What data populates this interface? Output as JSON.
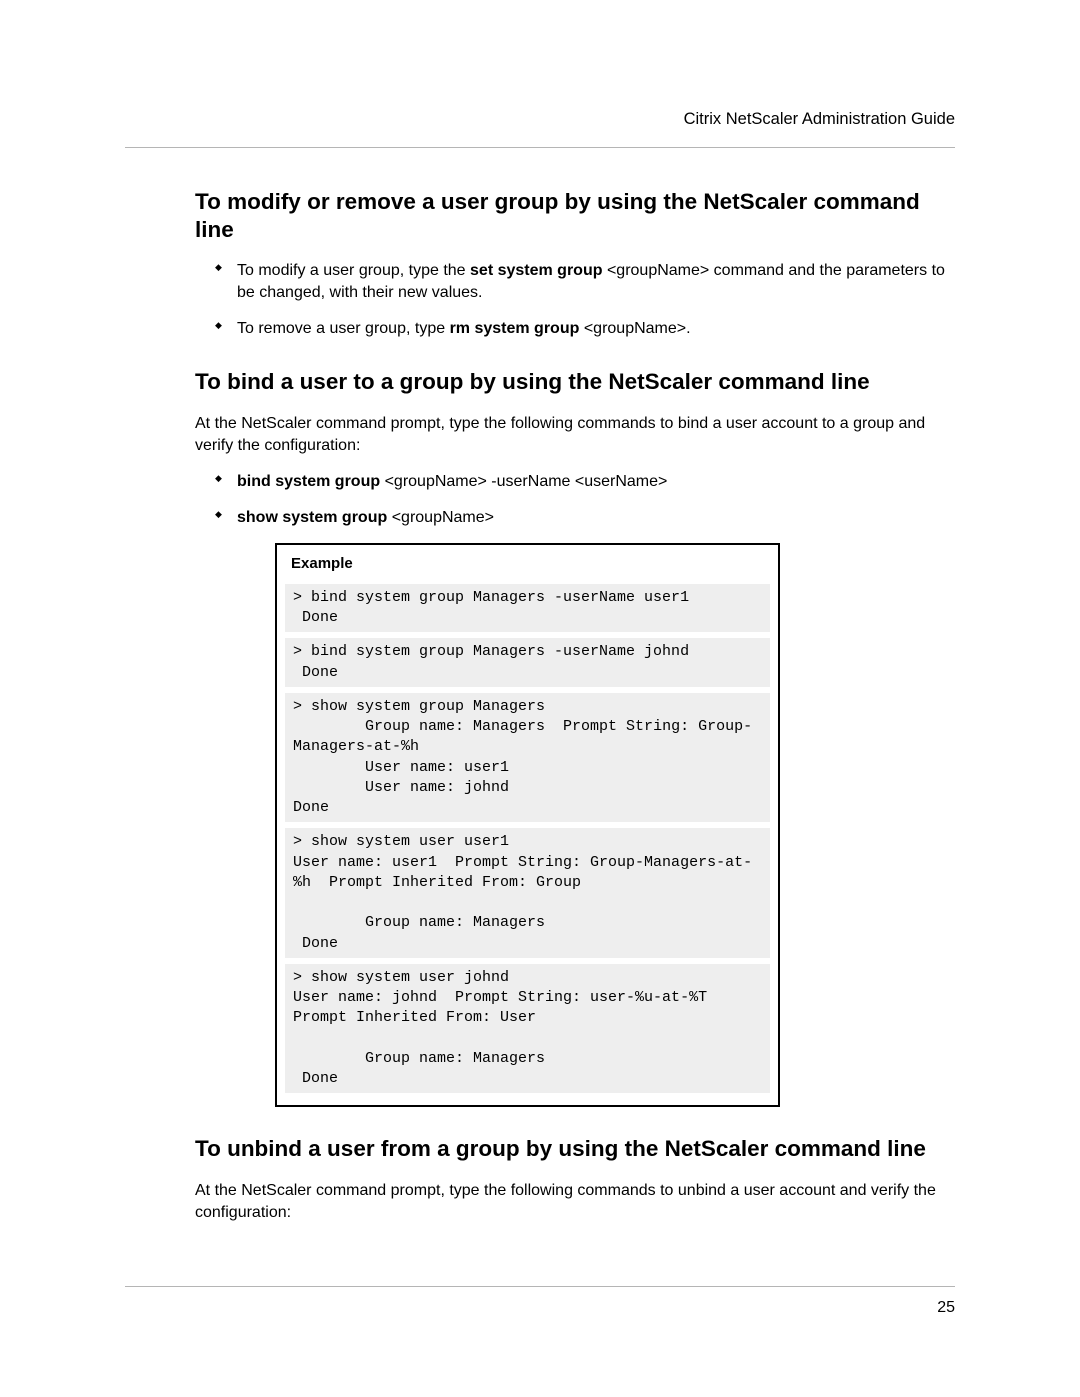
{
  "header": {
    "running_title": "Citrix NetScaler Administration Guide"
  },
  "section1": {
    "heading": "To modify or remove a user group by using the NetScaler command line",
    "bullet1_pre": "To modify a user group, type the ",
    "bullet1_cmd": "set system group",
    "bullet1_post": " <groupName> command and the parameters to be changed, with their new values.",
    "bullet2_pre": "To remove a user group, type ",
    "bullet2_cmd": "rm system group",
    "bullet2_post": " <groupName>."
  },
  "section2": {
    "heading": "To bind a user to a group by using the NetScaler command line",
    "intro": "At the NetScaler command prompt, type the following commands to bind a user account to a group and verify the configuration:",
    "b1_cmd": "bind system group",
    "b1_rest": " <groupName> -userName <userName>",
    "b2_cmd": "show system group",
    "b2_rest": " <groupName>",
    "example_label": "Example",
    "code1": "> bind system group Managers -userName user1\n Done",
    "code2": "> bind system group Managers -userName johnd\n Done",
    "code3": "> show system group Managers\n        Group name: Managers  Prompt String: Group-Managers-at-%h\n        User name: user1\n        User name: johnd\nDone",
    "code4": "> show system user user1\nUser name: user1  Prompt String: Group-Managers-at-%h  Prompt Inherited From: Group\n\n        Group name: Managers\n Done",
    "code5": "> show system user johnd\nUser name: johnd  Prompt String: user-%u-at-%T  Prompt Inherited From: User\n\n        Group name: Managers\n Done"
  },
  "section3": {
    "heading": "To unbind a user from a group by using the NetScaler command line",
    "intro": "At the NetScaler command prompt, type the following commands to unbind a user account and verify the configuration:"
  },
  "footer": {
    "page_number": "25"
  }
}
